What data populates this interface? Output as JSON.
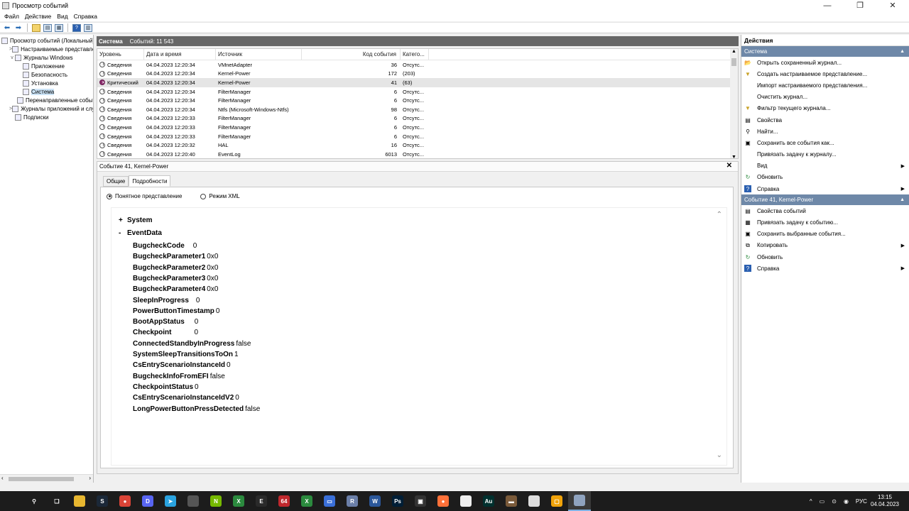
{
  "window": {
    "title": "Просмотр событий",
    "controls": [
      "—",
      "❐",
      "✕"
    ]
  },
  "menu": [
    "Файл",
    "Действие",
    "Вид",
    "Справка"
  ],
  "tree": [
    {
      "label": "Просмотр событий (Локальный)",
      "indent": 0,
      "twisty": ""
    },
    {
      "label": "Настраиваемые представления",
      "indent": 1,
      "twisty": ">"
    },
    {
      "label": "Журналы Windows",
      "indent": 1,
      "twisty": "v"
    },
    {
      "label": "Приложение",
      "indent": 2,
      "twisty": ""
    },
    {
      "label": "Безопасность",
      "indent": 2,
      "twisty": ""
    },
    {
      "label": "Установка",
      "indent": 2,
      "twisty": ""
    },
    {
      "label": "Система",
      "indent": 2,
      "twisty": "",
      "selected": true
    },
    {
      "label": "Перенаправленные события",
      "indent": 2,
      "twisty": ""
    },
    {
      "label": "Журналы приложений и служб",
      "indent": 1,
      "twisty": ">"
    },
    {
      "label": "Подписки",
      "indent": 1,
      "twisty": ""
    }
  ],
  "events_header": {
    "name": "Система",
    "count": "Событий: 11 543"
  },
  "columns": [
    "Уровень",
    "Дата и время",
    "Источник",
    "Код события",
    "Катего..."
  ],
  "events": [
    {
      "level": "Сведения",
      "date": "04.04.2023 12:20:34",
      "source": "VMnetAdapter",
      "code": "36",
      "category": "Отсутс..."
    },
    {
      "level": "Сведения",
      "date": "04.04.2023 12:20:34",
      "source": "Kernel-Power",
      "code": "172",
      "category": "(203)"
    },
    {
      "level": "Критический",
      "date": "04.04.2023 12:20:34",
      "source": "Kernel-Power",
      "code": "41",
      "category": "(63)",
      "critical": true,
      "selected": true
    },
    {
      "level": "Сведения",
      "date": "04.04.2023 12:20:34",
      "source": "FilterManager",
      "code": "6",
      "category": "Отсутс..."
    },
    {
      "level": "Сведения",
      "date": "04.04.2023 12:20:34",
      "source": "FilterManager",
      "code": "6",
      "category": "Отсутс..."
    },
    {
      "level": "Сведения",
      "date": "04.04.2023 12:20:34",
      "source": "Ntfs (Microsoft-Windows-Ntfs)",
      "code": "98",
      "category": "Отсутс..."
    },
    {
      "level": "Сведения",
      "date": "04.04.2023 12:20:33",
      "source": "FilterManager",
      "code": "6",
      "category": "Отсутс..."
    },
    {
      "level": "Сведения",
      "date": "04.04.2023 12:20:33",
      "source": "FilterManager",
      "code": "6",
      "category": "Отсутс..."
    },
    {
      "level": "Сведения",
      "date": "04.04.2023 12:20:33",
      "source": "FilterManager",
      "code": "6",
      "category": "Отсутс..."
    },
    {
      "level": "Сведения",
      "date": "04.04.2023 12:20:32",
      "source": "HAL",
      "code": "16",
      "category": "Отсутс..."
    },
    {
      "level": "Сведения",
      "date": "04.04.2023 12:20:40",
      "source": "EventLog",
      "code": "6013",
      "category": "Отсутс..."
    }
  ],
  "details": {
    "title": "Событие 41, Kernel-Power",
    "close": "✕",
    "tabs": [
      "Общие",
      "Подробности"
    ],
    "radio_friendly": "Понятное представление",
    "radio_xml": "Режим XML",
    "system_sign": "+",
    "system_label": "System",
    "eventdata_sign": "-",
    "eventdata_label": "EventData",
    "fields": [
      {
        "name": "BugcheckCode",
        "value": "0"
      },
      {
        "name": "BugcheckParameter1",
        "value": "0x0"
      },
      {
        "name": "BugcheckParameter2",
        "value": "0x0"
      },
      {
        "name": "BugcheckParameter3",
        "value": "0x0"
      },
      {
        "name": "BugcheckParameter4",
        "value": "0x0"
      },
      {
        "name": "SleepInProgress",
        "value": "0"
      },
      {
        "name": "PowerButtonTimestamp",
        "value": "0"
      },
      {
        "name": "BootAppStatus",
        "value": "0"
      },
      {
        "name": "Checkpoint",
        "value": "0"
      },
      {
        "name": "ConnectedStandbyInProgress",
        "value": "false"
      },
      {
        "name": "SystemSleepTransitionsToOn",
        "value": "1"
      },
      {
        "name": "CsEntryScenarioInstanceId",
        "value": "0"
      },
      {
        "name": "BugcheckInfoFromEFI",
        "value": "false"
      },
      {
        "name": "CheckpointStatus",
        "value": "0"
      },
      {
        "name": "CsEntryScenarioInstanceIdV2",
        "value": "0"
      },
      {
        "name": "LongPowerButtonPressDetected",
        "value": "false"
      }
    ]
  },
  "actions": {
    "title": "Действия",
    "section1": "Система",
    "items1": [
      {
        "label": "Открыть сохраненный журнал...",
        "icon": "folder-icon",
        "sym": "📂"
      },
      {
        "label": "Создать настраиваемое представление...",
        "icon": "filter-icon",
        "sym": "▼"
      },
      {
        "label": "Импорт настраиваемого представления...",
        "icon": "",
        "sym": ""
      },
      {
        "label": "Очистить журнал...",
        "icon": "",
        "sym": ""
      },
      {
        "label": "Фильтр текущего журнала...",
        "icon": "filter-icon",
        "sym": "▼"
      },
      {
        "label": "Свойства",
        "icon": "properties-icon",
        "sym": "▤"
      },
      {
        "label": "Найти...",
        "icon": "find-icon",
        "sym": "⚲"
      },
      {
        "label": "Сохранить все события как...",
        "icon": "save-icon",
        "sym": "▣"
      },
      {
        "label": "Привязать задачу к журналу...",
        "icon": "",
        "sym": ""
      },
      {
        "label": "Вид",
        "icon": "",
        "sym": "",
        "submenu": true
      },
      {
        "label": "Обновить",
        "icon": "refresh-icon",
        "sym": "↻"
      },
      {
        "label": "Справка",
        "icon": "help-icon",
        "sym": "?",
        "submenu": true
      }
    ],
    "section2": "Событие 41, Kernel-Power",
    "items2": [
      {
        "label": "Свойства событий",
        "icon": "properties-icon",
        "sym": "▤"
      },
      {
        "label": "Привязать задачу к событию...",
        "icon": "task-icon",
        "sym": "▦"
      },
      {
        "label": "Сохранить выбранные события...",
        "icon": "save-icon",
        "sym": "▣"
      },
      {
        "label": "Копировать",
        "icon": "copy-icon",
        "sym": "⧉",
        "submenu": true
      },
      {
        "label": "Обновить",
        "icon": "refresh-icon",
        "sym": "↻"
      },
      {
        "label": "Справка",
        "icon": "help-icon",
        "sym": "?",
        "submenu": true
      }
    ]
  },
  "taskbar": {
    "apps": [
      {
        "name": "search-icon",
        "color": "transparent",
        "text": "⚲"
      },
      {
        "name": "task-view-icon",
        "color": "transparent",
        "text": "❑"
      },
      {
        "name": "explorer-icon",
        "color": "#e8b730",
        "text": ""
      },
      {
        "name": "steam-icon",
        "color": "#1b2838",
        "text": "S"
      },
      {
        "name": "chrome-icon",
        "color": "#db4437",
        "text": "●"
      },
      {
        "name": "discord-icon",
        "color": "#5865f2",
        "text": "D"
      },
      {
        "name": "telegram-icon",
        "color": "#2aa3e0",
        "text": "➤"
      },
      {
        "name": "app-icon",
        "color": "#555",
        "text": ""
      },
      {
        "name": "nvidia-icon",
        "color": "#76b900",
        "text": "N"
      },
      {
        "name": "xbox-icon",
        "color": "#2b8a3e",
        "text": "X"
      },
      {
        "name": "epic-icon",
        "color": "#2a2a2a",
        "text": "E"
      },
      {
        "name": "aida64-icon",
        "color": "#c0282d",
        "text": "64"
      },
      {
        "name": "gamebar-icon",
        "color": "#2b8a3e",
        "text": "X"
      },
      {
        "name": "monitor-icon",
        "color": "#3a6fd8",
        "text": "▭"
      },
      {
        "name": "rdp-icon",
        "color": "#6b7fa8",
        "text": "R"
      },
      {
        "name": "word-icon",
        "color": "#2b579a",
        "text": "W"
      },
      {
        "name": "photoshop-icon",
        "color": "#001e36",
        "text": "Ps"
      },
      {
        "name": "capture-icon",
        "color": "#333",
        "text": "▣"
      },
      {
        "name": "firefox-icon",
        "color": "#ff7139",
        "text": "●"
      },
      {
        "name": "file-icon",
        "color": "#eee",
        "text": ""
      },
      {
        "name": "audition-icon",
        "color": "#00302e",
        "text": "Au"
      },
      {
        "name": "tool-icon",
        "color": "#7a5a3a",
        "text": "▬"
      },
      {
        "name": "notepad-icon",
        "color": "#ddd",
        "text": ""
      },
      {
        "name": "virtualbox-icon",
        "color": "#f0a30a",
        "text": "▢"
      },
      {
        "name": "eventviewer-icon",
        "color": "#8fa3bf",
        "text": ""
      }
    ],
    "tray": [
      "^",
      "▭",
      "⊙",
      "◉",
      "РУС"
    ],
    "time": "13:15",
    "date": "04.04.2023"
  }
}
